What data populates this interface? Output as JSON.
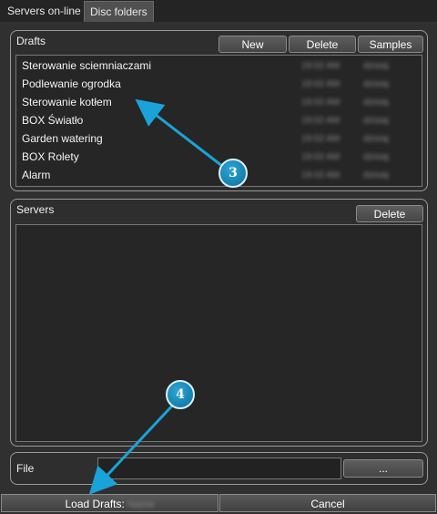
{
  "tabs": [
    {
      "label": "Servers on-line"
    },
    {
      "label": "Disc folders"
    }
  ],
  "drafts": {
    "label": "Drafts",
    "buttons": {
      "new": "New",
      "delete": "Delete",
      "samples": "Samples"
    },
    "items": [
      {
        "name": "Sterowanie sciemniaczami",
        "time": "19:02 AM",
        "date": "dzisiaj"
      },
      {
        "name": "Podlewanie ogrodka",
        "time": "19:02 AM",
        "date": "dzisiaj"
      },
      {
        "name": "Sterowanie kotłem",
        "time": "19:02 AM",
        "date": "dzisiaj"
      },
      {
        "name": "BOX Światło",
        "time": "19:02 AM",
        "date": "dzisiaj"
      },
      {
        "name": "Garden watering",
        "time": "19:02 AM",
        "date": "dzisiaj"
      },
      {
        "name": "BOX Rolety",
        "time": "19:02 AM",
        "date": "dzisiaj"
      },
      {
        "name": "Alarm",
        "time": "19:02 AM",
        "date": "dzisiaj"
      }
    ]
  },
  "servers": {
    "label": "Servers",
    "delete_label": "Delete"
  },
  "file": {
    "label": "File",
    "value": "",
    "browse_label": "..."
  },
  "bottom": {
    "load_label": "Load Drafts:",
    "load_blurred": "Name",
    "cancel_label": "Cancel"
  },
  "callouts": {
    "first": "3",
    "second": "4"
  },
  "colors": {
    "accent": "#1aa3d9",
    "background": "#303030"
  }
}
